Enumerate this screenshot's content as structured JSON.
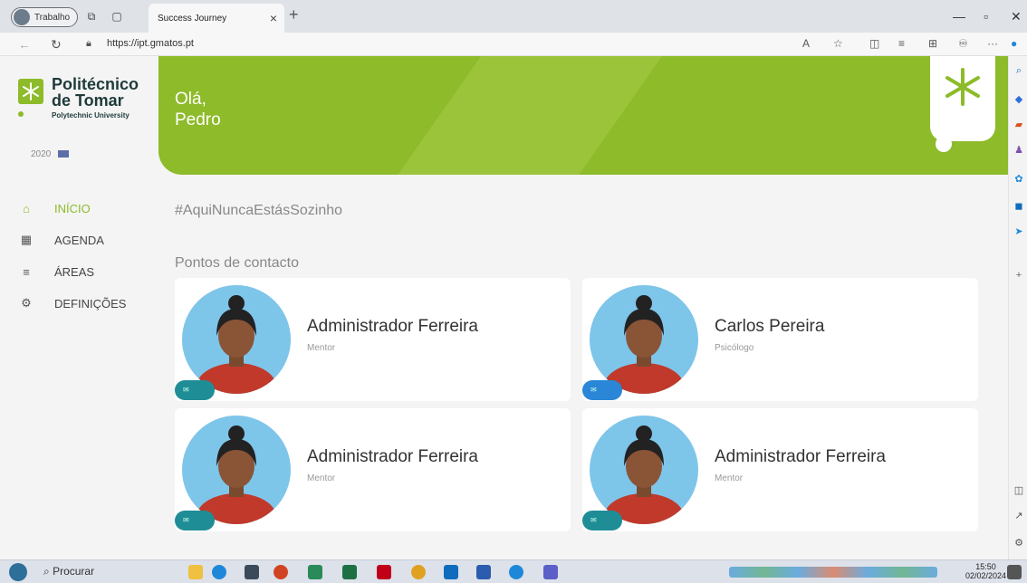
{
  "browser": {
    "profile_label": "Trabalho",
    "tab_title": "Success Journey",
    "url": "https://ipt.gmatos.pt"
  },
  "sidebar": {
    "logo_line1": "Politécnico",
    "logo_line2": "de Tomar",
    "logo_sub": "Polytechnic University",
    "funding_text": "2020",
    "items": [
      {
        "label": "INÍCIO",
        "icon": "home-icon",
        "active": true
      },
      {
        "label": "AGENDA",
        "icon": "calendar-icon",
        "active": false
      },
      {
        "label": "ÁREAS",
        "icon": "menu-icon",
        "active": false
      },
      {
        "label": "DEFINIÇÕES",
        "icon": "settings-icon",
        "active": false
      }
    ]
  },
  "banner": {
    "greeting_line1": "Olá,",
    "greeting_line2": "Pedro"
  },
  "main": {
    "hashtag": "#AquiNuncaEstásSozinho",
    "section_title": "Pontos de contacto",
    "contacts": [
      {
        "name": "Administrador Ferreira",
        "role": "Mentor"
      },
      {
        "name": "Carlos Pereira",
        "role": "Psicólogo"
      },
      {
        "name": "Administrador Ferreira",
        "role": "Mentor"
      },
      {
        "name": "Administrador Ferreira",
        "role": "Mentor"
      }
    ]
  },
  "taskbar": {
    "search_placeholder": "Procurar",
    "time": "15:50",
    "date": "02/02/2024"
  },
  "colors": {
    "brand_green": "#8dbb2a",
    "avatar_bg": "#7ec5ea",
    "chip_teal": "#1f8d96",
    "chip_blue": "#2a86d6"
  }
}
